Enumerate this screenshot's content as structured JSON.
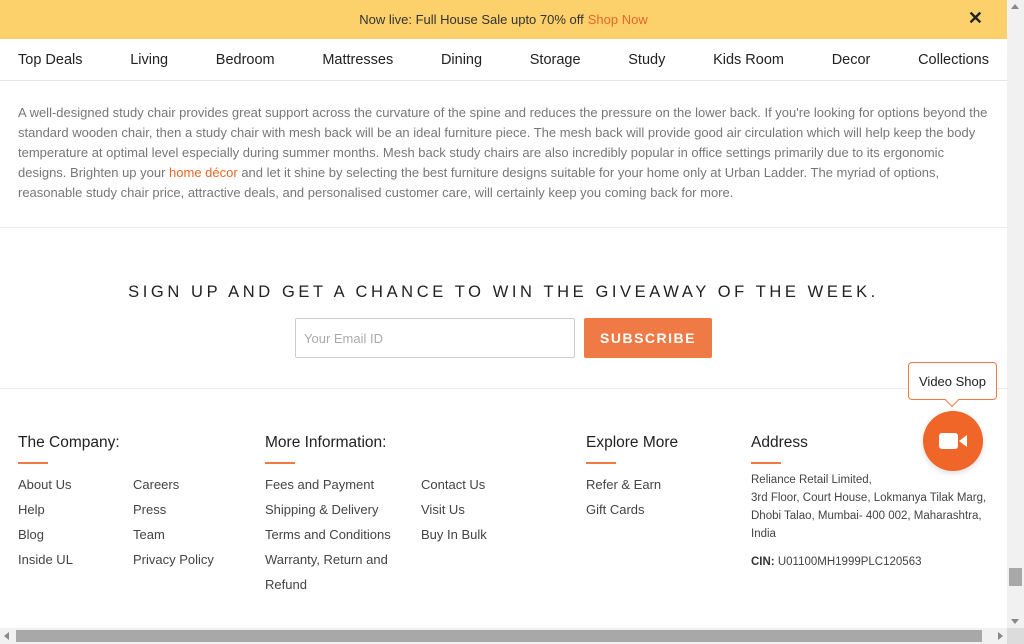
{
  "promo": {
    "text": "Now live: Full House Sale upto 70% off",
    "link": "Shop Now",
    "close": "✕"
  },
  "nav": {
    "items": [
      "Top Deals",
      "Living",
      "Bedroom",
      "Mattresses",
      "Dining",
      "Storage",
      "Study",
      "Kids Room",
      "Decor",
      "Collections"
    ]
  },
  "description": {
    "text_before": "A well-designed study chair provides great support across the curvature of the spine and reduces the pressure on the lower back. If you're looking for options beyond the standard wooden chair, then a study chair with mesh back will be an ideal furniture piece. The mesh back will provide good air circulation which will help keep the body temperature at optimal level especially during summer months. Mesh back study chairs are also incredibly popular in office settings primarily due to its ergonomic designs. Brighten up your ",
    "link": "home décor",
    "text_after": " and let it shine by selecting the best furniture designs suitable for your home only at Urban Ladder. The myriad of options, reasonable study chair price, attractive deals, and personalised customer care, will certainly keep you coming back for more."
  },
  "signup": {
    "title": "SIGN UP AND GET A CHANCE TO WIN THE GIVEAWAY OF THE WEEK.",
    "placeholder": "Your Email ID",
    "button": "SUBSCRIBE"
  },
  "footer": {
    "company": {
      "title": "The Company:",
      "col1": [
        "About Us",
        "Help",
        "Blog",
        "Inside UL"
      ],
      "col2": [
        "Careers",
        "Press",
        "Team",
        "Privacy Policy"
      ]
    },
    "more_info": {
      "title": "More Information:",
      "col1": [
        "Fees and Payment",
        "Shipping & Delivery",
        "Terms and Conditions",
        "Warranty, Return and",
        "Refund"
      ],
      "col2": [
        "Contact Us",
        "Visit Us",
        "Buy In Bulk"
      ]
    },
    "explore": {
      "title": "Explore More",
      "items": [
        "Refer & Earn",
        "Gift Cards"
      ]
    },
    "address": {
      "title": "Address",
      "lines": [
        "Reliance Retail Limited,",
        "3rd Floor, Court House, Lokmanya Tilak Marg,",
        "Dhobi Talao, Mumbai- 400 002, Maharashtra,",
        "India"
      ],
      "cin_label": "CIN:",
      "cin_value": "U01100MH1999PLC120563"
    }
  },
  "video_shop": {
    "label": "Video Shop",
    "icon": "video-camera-icon"
  },
  "colors": {
    "promo_bg": "#fcd06a",
    "accent": "#f07a45",
    "video_button": "#f06528"
  }
}
